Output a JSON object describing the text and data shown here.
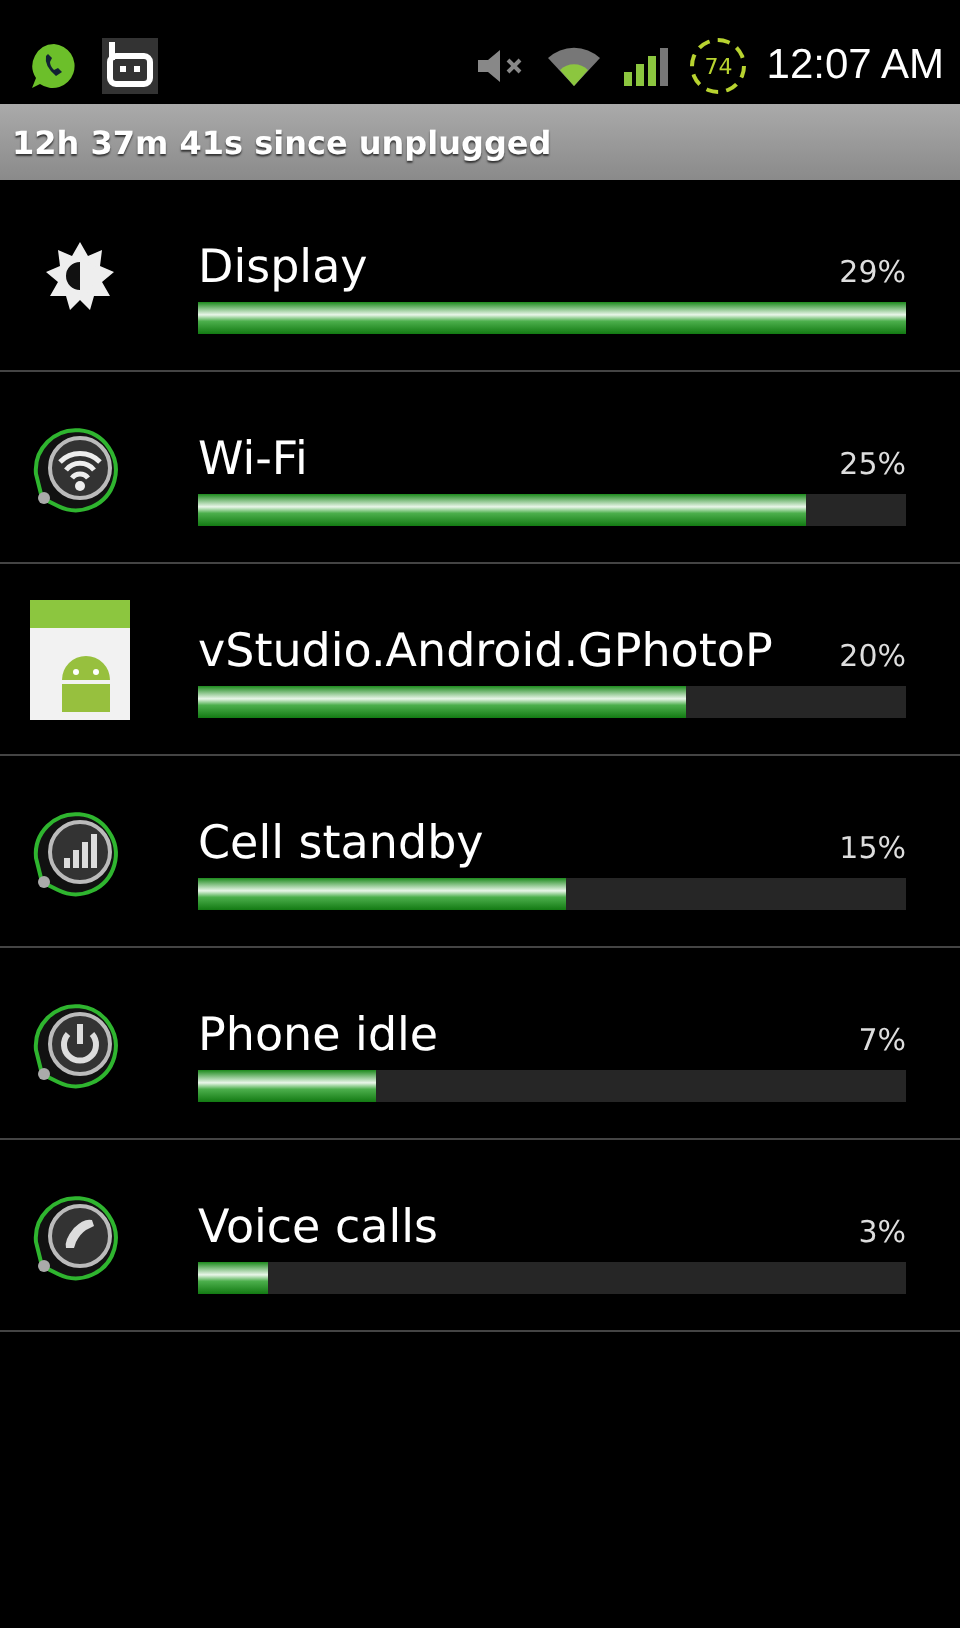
{
  "status_bar": {
    "battery": "74",
    "time": "12:07 AM"
  },
  "header": {
    "text": "12h 37m 41s since unplugged"
  },
  "items": [
    {
      "kind": "display",
      "name": "Display",
      "percent": "29%",
      "level": 1.0
    },
    {
      "kind": "wifi",
      "name": "Wi-Fi",
      "percent": "25%",
      "level": 0.86
    },
    {
      "kind": "app",
      "name": "vStudio.Android.GPhotoP",
      "percent": "20%",
      "level": 0.69
    },
    {
      "kind": "signal",
      "name": "Cell standby",
      "percent": "15%",
      "level": 0.52
    },
    {
      "kind": "power",
      "name": "Phone idle",
      "percent": "7%",
      "level": 0.25
    },
    {
      "kind": "phone",
      "name": "Voice calls",
      "percent": "3%",
      "level": 0.1
    }
  ]
}
